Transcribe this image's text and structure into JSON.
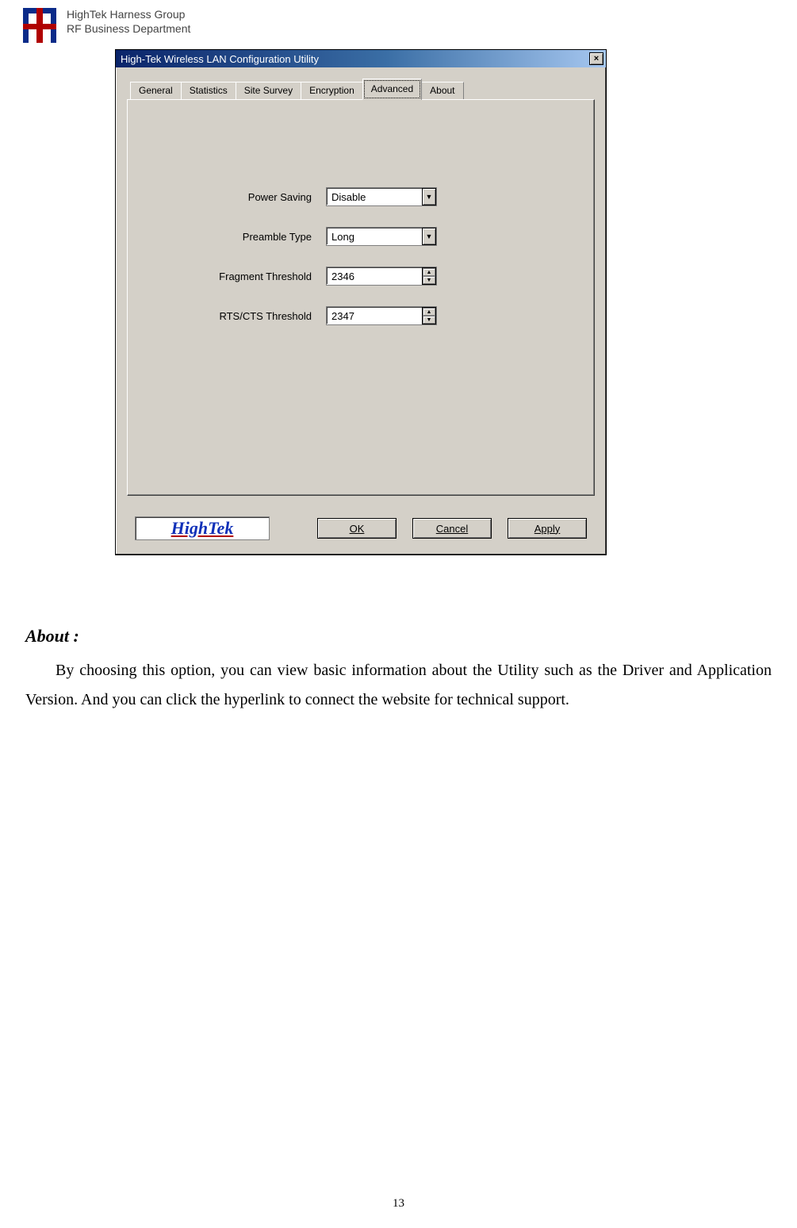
{
  "header": {
    "line1": "HighTek Harness Group",
    "line2": "RF Business Department"
  },
  "dialog": {
    "title": "High-Tek Wireless LAN Configuration Utility",
    "close_glyph": "×",
    "tabs": [
      "General",
      "Statistics",
      "Site Survey",
      "Encryption",
      "Advanced",
      "About"
    ],
    "active_tab_index": 4,
    "fields": {
      "power_saving": {
        "label": "Power Saving",
        "value": "Disable"
      },
      "preamble_type": {
        "label": "Preamble Type",
        "value": "Long"
      },
      "fragment_threshold": {
        "label": "Fragment Threshold",
        "value": "2346"
      },
      "rts_cts_threshold": {
        "label": "RTS/CTS Threshold",
        "value": "2347"
      }
    },
    "brand": "HighTek",
    "buttons": {
      "ok": "OK",
      "cancel": "Cancel",
      "apply": "Apply"
    }
  },
  "section": {
    "heading": "About :",
    "paragraph": "By choosing this option, you can view basic information about the Utility such as the Driver and Application Version.  And you can click the hyperlink to connect the website for technical support."
  },
  "page_number": "13"
}
